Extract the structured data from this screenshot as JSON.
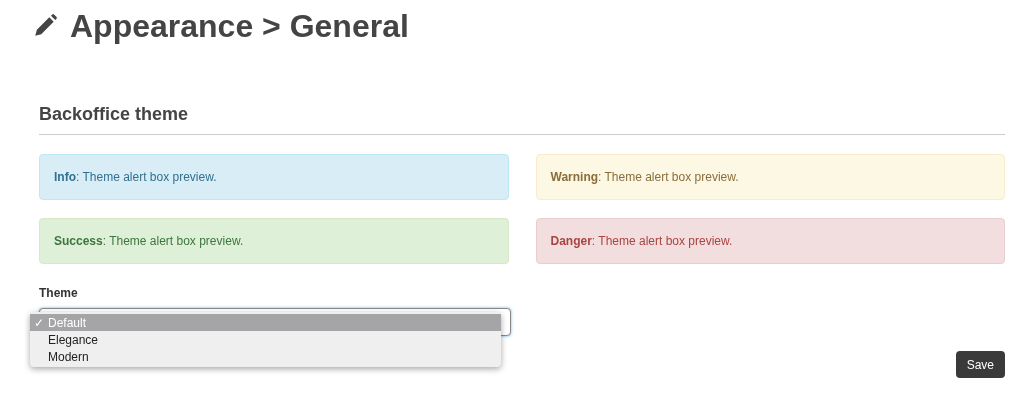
{
  "page_title": "Appearance > General",
  "section_title": "Backoffice theme",
  "alerts": [
    {
      "kind": "info",
      "text": "**Info**: Theme alert box preview."
    },
    {
      "kind": "warning",
      "text": "**Warning**: Theme alert box preview."
    },
    {
      "kind": "success",
      "text": "**Success**: Theme alert box preview."
    },
    {
      "kind": "danger",
      "text": "**Danger**: Theme alert box preview."
    }
  ],
  "theme": {
    "label": "Theme",
    "check_mark": "✓",
    "options": [
      {
        "label": "Default",
        "selected": true
      },
      {
        "label": "Elegance",
        "selected": false
      },
      {
        "label": "Modern",
        "selected": false
      }
    ]
  },
  "buttons": [
    {
      "label": "Save"
    }
  ]
}
